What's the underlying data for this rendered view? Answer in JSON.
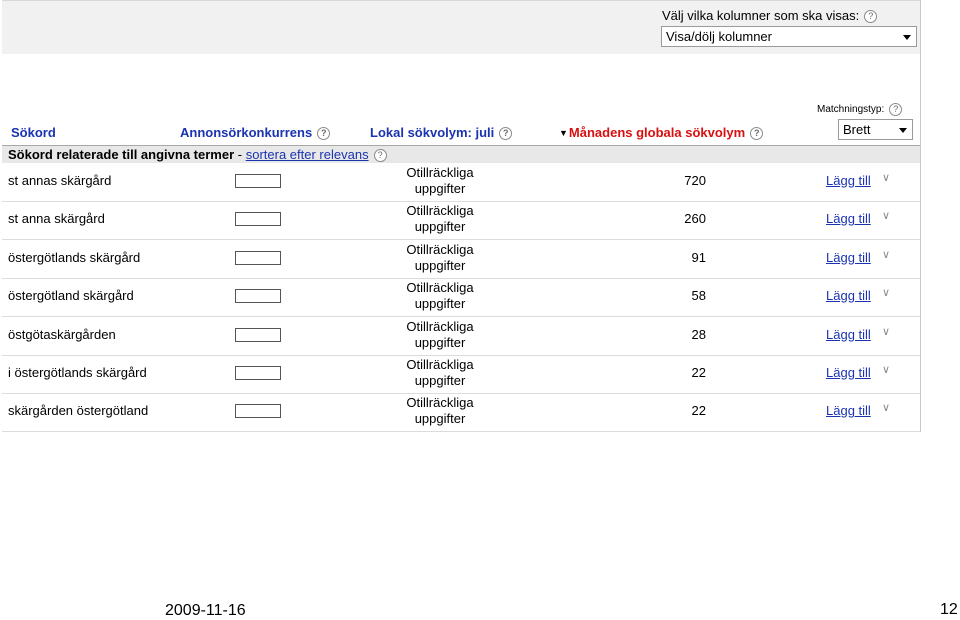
{
  "column_chooser": {
    "label": "Välj vilka kolumner som ska visas:",
    "selected": "Visa/dölj kolumner"
  },
  "match_type": {
    "label": "Matchningstyp:",
    "selected": "Brett"
  },
  "columns": {
    "keyword": "Sökord",
    "competition": "Annonsörkonkurrens",
    "local_volume": "Lokal sökvolym: juli",
    "global_volume": "Månadens globala sökvolym"
  },
  "section": {
    "title": "Sökord relaterade till angivna termer",
    "separator": "-",
    "sort_link": "sortera efter relevans"
  },
  "rows": [
    {
      "keyword": "st annas skärgård",
      "local_1": "Otillräckliga",
      "local_2": "uppgifter",
      "global": "720",
      "add": "Lägg till"
    },
    {
      "keyword": "st anna skärgård",
      "local_1": "Otillräckliga",
      "local_2": "uppgifter",
      "global": "260",
      "add": "Lägg till"
    },
    {
      "keyword": "östergötlands skärgård",
      "local_1": "Otillräckliga",
      "local_2": "uppgifter",
      "global": "91",
      "add": "Lägg till"
    },
    {
      "keyword": "östergötland skärgård",
      "local_1": "Otillräckliga",
      "local_2": "uppgifter",
      "global": "58",
      "add": "Lägg till"
    },
    {
      "keyword": "östgötaskärgården",
      "local_1": "Otillräckliga",
      "local_2": "uppgifter",
      "global": "28",
      "add": "Lägg till"
    },
    {
      "keyword": "i östergötlands skärgård",
      "local_1": "Otillräckliga",
      "local_2": "uppgifter",
      "global": "22",
      "add": "Lägg till"
    },
    {
      "keyword": "skärgården östergötland",
      "local_1": "Otillräckliga",
      "local_2": "uppgifter",
      "global": "22",
      "add": "Lägg till"
    }
  ],
  "footer": {
    "date": "2009-11-16",
    "page": "12"
  },
  "colors": {
    "link": "#1a33b0",
    "sorted_header": "#d81010"
  },
  "icons": {
    "help": "help-icon",
    "add_more": "chevron-down-icon"
  }
}
